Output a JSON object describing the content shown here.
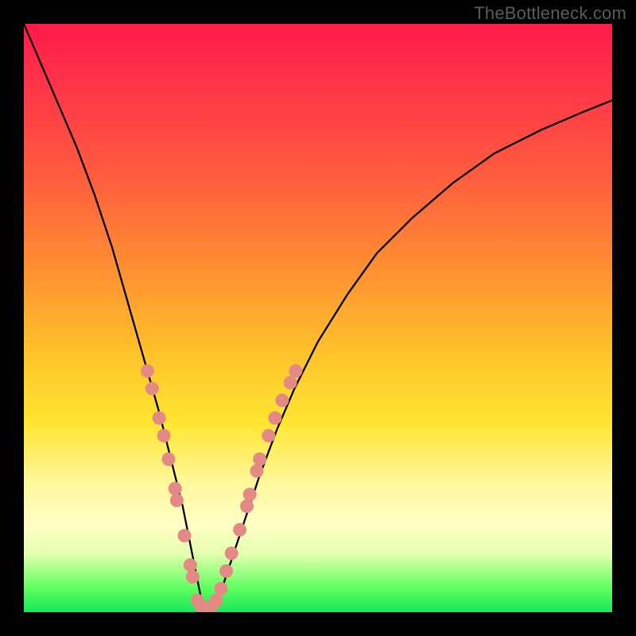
{
  "watermark": "TheBottleneck.com",
  "chart_data": {
    "type": "line",
    "title": "",
    "xlabel": "",
    "ylabel": "",
    "xlim": [
      0,
      100
    ],
    "ylim": [
      0,
      100
    ],
    "series": [
      {
        "name": "bottleneck-curve",
        "x": [
          0,
          3,
          6,
          9,
          12,
          15,
          17,
          19,
          21,
          23,
          25,
          27,
          28,
          29,
          30,
          31,
          32,
          34,
          36,
          38,
          40,
          43,
          46,
          50,
          55,
          60,
          66,
          73,
          80,
          88,
          95,
          100
        ],
        "y": [
          100,
          93,
          86,
          79,
          71,
          62,
          55,
          48,
          41,
          34,
          26,
          18,
          13,
          8,
          3,
          0,
          1,
          5,
          11,
          17,
          23,
          31,
          38,
          46,
          54,
          61,
          67,
          73,
          78,
          82,
          85,
          87
        ]
      }
    ],
    "markers": {
      "name": "highlighted-points",
      "color": "#e48a84",
      "points": [
        {
          "x": 21.0,
          "y": 41
        },
        {
          "x": 21.8,
          "y": 38
        },
        {
          "x": 23.0,
          "y": 33
        },
        {
          "x": 23.8,
          "y": 30
        },
        {
          "x": 24.6,
          "y": 26
        },
        {
          "x": 25.7,
          "y": 21
        },
        {
          "x": 26.0,
          "y": 19
        },
        {
          "x": 27.3,
          "y": 13
        },
        {
          "x": 28.3,
          "y": 8
        },
        {
          "x": 28.7,
          "y": 6
        },
        {
          "x": 29.5,
          "y": 2
        },
        {
          "x": 30.2,
          "y": 1
        },
        {
          "x": 31.0,
          "y": 0
        },
        {
          "x": 31.9,
          "y": 1
        },
        {
          "x": 32.7,
          "y": 2
        },
        {
          "x": 33.5,
          "y": 4
        },
        {
          "x": 34.4,
          "y": 7
        },
        {
          "x": 35.3,
          "y": 10
        },
        {
          "x": 36.7,
          "y": 14
        },
        {
          "x": 37.9,
          "y": 18
        },
        {
          "x": 38.4,
          "y": 20
        },
        {
          "x": 39.6,
          "y": 24
        },
        {
          "x": 40.1,
          "y": 26
        },
        {
          "x": 41.6,
          "y": 30
        },
        {
          "x": 42.7,
          "y": 33
        },
        {
          "x": 43.9,
          "y": 36
        },
        {
          "x": 45.3,
          "y": 39
        },
        {
          "x": 46.2,
          "y": 41
        }
      ]
    }
  }
}
